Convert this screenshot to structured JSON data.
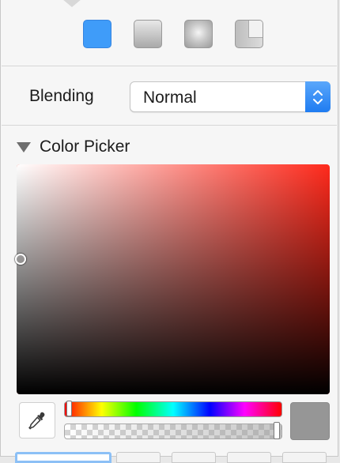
{
  "fill_types": [
    {
      "name": "solid",
      "selected": true
    },
    {
      "name": "linear-gradient",
      "selected": false
    },
    {
      "name": "radial-gradient",
      "selected": false
    },
    {
      "name": "angular-gradient",
      "selected": false
    }
  ],
  "blending": {
    "label": "Blending",
    "value": "Normal"
  },
  "color_picker": {
    "title": "Color Picker",
    "expanded": true,
    "hue_color": "#ff2a1c",
    "swatch_color": "#969696",
    "hue_value": 0,
    "alpha_value": 1.0
  },
  "colors": {
    "accent": "#3f9cf9",
    "stepper": "#1f7cf1"
  }
}
